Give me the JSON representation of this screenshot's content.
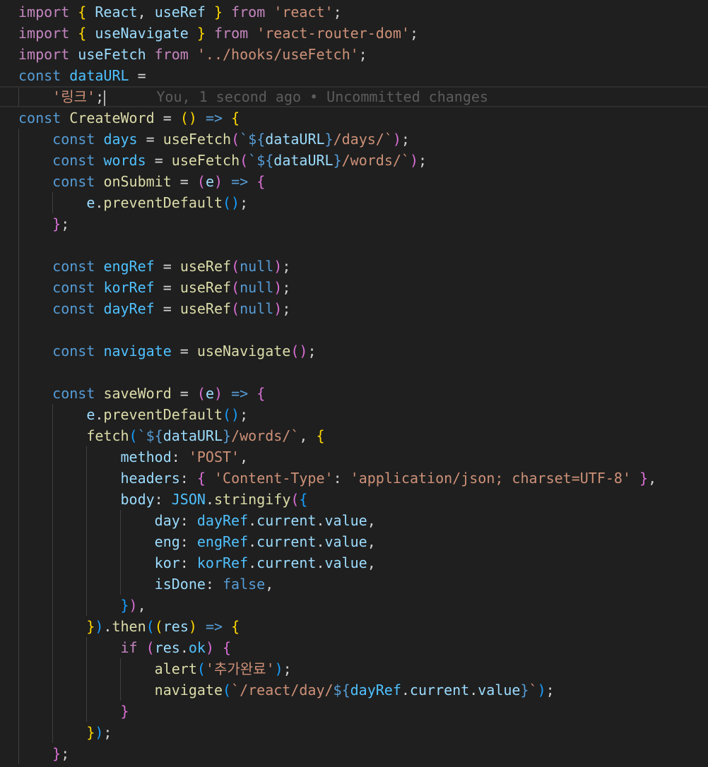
{
  "colors": {
    "background": "#1f1f1f",
    "keyword": "#c586c0",
    "storage": "#569cd6",
    "variable": "#9cdcfe",
    "constant": "#4fc1ff",
    "function": "#dcdcaa",
    "string": "#ce9178",
    "punctuation": "#d4d4d4",
    "bracket_gold": "#ffd700",
    "bracket_purple": "#da70d6",
    "bracket_blue": "#179fff",
    "blame": "#5c5c5c"
  },
  "git_blame": "You, 1 second ago • Uncommitted changes",
  "code_lines": [
    [
      [
        "import",
        "keyword"
      ],
      [
        " ",
        "punctuation"
      ],
      [
        "{",
        "bracket_gold"
      ],
      [
        " ",
        "punctuation"
      ],
      [
        "React",
        "variable"
      ],
      [
        ", ",
        "punctuation"
      ],
      [
        "useRef",
        "variable"
      ],
      [
        " ",
        "punctuation"
      ],
      [
        "}",
        "bracket_gold"
      ],
      [
        " ",
        "punctuation"
      ],
      [
        "from",
        "keyword"
      ],
      [
        " ",
        "punctuation"
      ],
      [
        "'react'",
        "string"
      ],
      [
        ";",
        "punctuation"
      ]
    ],
    [
      [
        "import",
        "keyword"
      ],
      [
        " ",
        "punctuation"
      ],
      [
        "{",
        "bracket_gold"
      ],
      [
        " ",
        "punctuation"
      ],
      [
        "useNavigate",
        "variable"
      ],
      [
        " ",
        "punctuation"
      ],
      [
        "}",
        "bracket_gold"
      ],
      [
        " ",
        "punctuation"
      ],
      [
        "from",
        "keyword"
      ],
      [
        " ",
        "punctuation"
      ],
      [
        "'react-router-dom'",
        "string"
      ],
      [
        ";",
        "punctuation"
      ]
    ],
    [
      [
        "import",
        "keyword"
      ],
      [
        " ",
        "punctuation"
      ],
      [
        "useFetch",
        "variable"
      ],
      [
        " ",
        "punctuation"
      ],
      [
        "from",
        "keyword"
      ],
      [
        " ",
        "punctuation"
      ],
      [
        "'../hooks/useFetch'",
        "string"
      ],
      [
        ";",
        "punctuation"
      ]
    ],
    [
      [
        "const",
        "storage"
      ],
      [
        " ",
        "punctuation"
      ],
      [
        "dataURL",
        "constant"
      ],
      [
        " =",
        "punctuation"
      ]
    ],
    [
      [
        "    ",
        "punctuation"
      ],
      [
        "'링크'",
        "string"
      ],
      [
        ";",
        "punctuation"
      ]
    ],
    [
      [
        "const",
        "storage"
      ],
      [
        " ",
        "punctuation"
      ],
      [
        "CreateWord",
        "function"
      ],
      [
        " = ",
        "punctuation"
      ],
      [
        "()",
        "bracket_gold"
      ],
      [
        " ",
        "punctuation"
      ],
      [
        "=>",
        "storage"
      ],
      [
        " ",
        "punctuation"
      ],
      [
        "{",
        "bracket_gold"
      ]
    ],
    [
      [
        "    ",
        "punctuation"
      ],
      [
        "const",
        "storage"
      ],
      [
        " ",
        "punctuation"
      ],
      [
        "days",
        "constant"
      ],
      [
        " = ",
        "punctuation"
      ],
      [
        "useFetch",
        "function"
      ],
      [
        "(",
        "bracket_purple"
      ],
      [
        "`${",
        "storage"
      ],
      [
        "dataURL",
        "variable"
      ],
      [
        "}",
        "storage"
      ],
      [
        "/days/`",
        "string"
      ],
      [
        ")",
        "bracket_purple"
      ],
      [
        ";",
        "punctuation"
      ]
    ],
    [
      [
        "    ",
        "punctuation"
      ],
      [
        "const",
        "storage"
      ],
      [
        " ",
        "punctuation"
      ],
      [
        "words",
        "constant"
      ],
      [
        " = ",
        "punctuation"
      ],
      [
        "useFetch",
        "function"
      ],
      [
        "(",
        "bracket_purple"
      ],
      [
        "`${",
        "storage"
      ],
      [
        "dataURL",
        "variable"
      ],
      [
        "}",
        "storage"
      ],
      [
        "/words/`",
        "string"
      ],
      [
        ")",
        "bracket_purple"
      ],
      [
        ";",
        "punctuation"
      ]
    ],
    [
      [
        "    ",
        "punctuation"
      ],
      [
        "const",
        "storage"
      ],
      [
        " ",
        "punctuation"
      ],
      [
        "onSubmit",
        "function"
      ],
      [
        " = ",
        "punctuation"
      ],
      [
        "(",
        "bracket_purple"
      ],
      [
        "e",
        "variable"
      ],
      [
        ")",
        "bracket_purple"
      ],
      [
        " ",
        "punctuation"
      ],
      [
        "=>",
        "storage"
      ],
      [
        " ",
        "punctuation"
      ],
      [
        "{",
        "bracket_purple"
      ]
    ],
    [
      [
        "        ",
        "punctuation"
      ],
      [
        "e",
        "variable"
      ],
      [
        ".",
        "punctuation"
      ],
      [
        "preventDefault",
        "function"
      ],
      [
        "()",
        "bracket_blue"
      ],
      [
        ";",
        "punctuation"
      ]
    ],
    [
      [
        "    ",
        "punctuation"
      ],
      [
        "}",
        "bracket_purple"
      ],
      [
        ";",
        "punctuation"
      ]
    ],
    [],
    [
      [
        "    ",
        "punctuation"
      ],
      [
        "const",
        "storage"
      ],
      [
        " ",
        "punctuation"
      ],
      [
        "engRef",
        "constant"
      ],
      [
        " = ",
        "punctuation"
      ],
      [
        "useRef",
        "function"
      ],
      [
        "(",
        "bracket_purple"
      ],
      [
        "null",
        "storage"
      ],
      [
        ")",
        "bracket_purple"
      ],
      [
        ";",
        "punctuation"
      ]
    ],
    [
      [
        "    ",
        "punctuation"
      ],
      [
        "const",
        "storage"
      ],
      [
        " ",
        "punctuation"
      ],
      [
        "korRef",
        "constant"
      ],
      [
        " = ",
        "punctuation"
      ],
      [
        "useRef",
        "function"
      ],
      [
        "(",
        "bracket_purple"
      ],
      [
        "null",
        "storage"
      ],
      [
        ")",
        "bracket_purple"
      ],
      [
        ";",
        "punctuation"
      ]
    ],
    [
      [
        "    ",
        "punctuation"
      ],
      [
        "const",
        "storage"
      ],
      [
        " ",
        "punctuation"
      ],
      [
        "dayRef",
        "constant"
      ],
      [
        " = ",
        "punctuation"
      ],
      [
        "useRef",
        "function"
      ],
      [
        "(",
        "bracket_purple"
      ],
      [
        "null",
        "storage"
      ],
      [
        ")",
        "bracket_purple"
      ],
      [
        ";",
        "punctuation"
      ]
    ],
    [],
    [
      [
        "    ",
        "punctuation"
      ],
      [
        "const",
        "storage"
      ],
      [
        " ",
        "punctuation"
      ],
      [
        "navigate",
        "constant"
      ],
      [
        " = ",
        "punctuation"
      ],
      [
        "useNavigate",
        "function"
      ],
      [
        "()",
        "bracket_purple"
      ],
      [
        ";",
        "punctuation"
      ]
    ],
    [],
    [
      [
        "    ",
        "punctuation"
      ],
      [
        "const",
        "storage"
      ],
      [
        " ",
        "punctuation"
      ],
      [
        "saveWord",
        "function"
      ],
      [
        " = ",
        "punctuation"
      ],
      [
        "(",
        "bracket_purple"
      ],
      [
        "e",
        "variable"
      ],
      [
        ")",
        "bracket_purple"
      ],
      [
        " ",
        "punctuation"
      ],
      [
        "=>",
        "storage"
      ],
      [
        " ",
        "punctuation"
      ],
      [
        "{",
        "bracket_purple"
      ]
    ],
    [
      [
        "        ",
        "punctuation"
      ],
      [
        "e",
        "variable"
      ],
      [
        ".",
        "punctuation"
      ],
      [
        "preventDefault",
        "function"
      ],
      [
        "()",
        "bracket_blue"
      ],
      [
        ";",
        "punctuation"
      ]
    ],
    [
      [
        "        ",
        "punctuation"
      ],
      [
        "fetch",
        "function"
      ],
      [
        "(",
        "bracket_blue"
      ],
      [
        "`${",
        "storage"
      ],
      [
        "dataURL",
        "variable"
      ],
      [
        "}",
        "storage"
      ],
      [
        "/words/`",
        "string"
      ],
      [
        ", ",
        "punctuation"
      ],
      [
        "{",
        "bracket_gold"
      ]
    ],
    [
      [
        "            ",
        "punctuation"
      ],
      [
        "method",
        "variable"
      ],
      [
        ": ",
        "punctuation"
      ],
      [
        "'POST'",
        "string"
      ],
      [
        ",",
        "punctuation"
      ]
    ],
    [
      [
        "            ",
        "punctuation"
      ],
      [
        "headers",
        "variable"
      ],
      [
        ": ",
        "punctuation"
      ],
      [
        "{",
        "bracket_purple"
      ],
      [
        " ",
        "punctuation"
      ],
      [
        "'Content-Type'",
        "string"
      ],
      [
        ": ",
        "punctuation"
      ],
      [
        "'application/json; charset=UTF-8'",
        "string"
      ],
      [
        " ",
        "punctuation"
      ],
      [
        "}",
        "bracket_purple"
      ],
      [
        ",",
        "punctuation"
      ]
    ],
    [
      [
        "            ",
        "punctuation"
      ],
      [
        "body",
        "variable"
      ],
      [
        ": ",
        "punctuation"
      ],
      [
        "JSON",
        "constant"
      ],
      [
        ".",
        "punctuation"
      ],
      [
        "stringify",
        "function"
      ],
      [
        "(",
        "bracket_purple"
      ],
      [
        "{",
        "bracket_blue"
      ]
    ],
    [
      [
        "                ",
        "punctuation"
      ],
      [
        "day",
        "variable"
      ],
      [
        ": ",
        "punctuation"
      ],
      [
        "dayRef",
        "constant"
      ],
      [
        ".",
        "punctuation"
      ],
      [
        "current",
        "variable"
      ],
      [
        ".",
        "punctuation"
      ],
      [
        "value",
        "variable"
      ],
      [
        ",",
        "punctuation"
      ]
    ],
    [
      [
        "                ",
        "punctuation"
      ],
      [
        "eng",
        "variable"
      ],
      [
        ": ",
        "punctuation"
      ],
      [
        "engRef",
        "constant"
      ],
      [
        ".",
        "punctuation"
      ],
      [
        "current",
        "variable"
      ],
      [
        ".",
        "punctuation"
      ],
      [
        "value",
        "variable"
      ],
      [
        ",",
        "punctuation"
      ]
    ],
    [
      [
        "                ",
        "punctuation"
      ],
      [
        "kor",
        "variable"
      ],
      [
        ": ",
        "punctuation"
      ],
      [
        "korRef",
        "constant"
      ],
      [
        ".",
        "punctuation"
      ],
      [
        "current",
        "variable"
      ],
      [
        ".",
        "punctuation"
      ],
      [
        "value",
        "variable"
      ],
      [
        ",",
        "punctuation"
      ]
    ],
    [
      [
        "                ",
        "punctuation"
      ],
      [
        "isDone",
        "variable"
      ],
      [
        ": ",
        "punctuation"
      ],
      [
        "false",
        "storage"
      ],
      [
        ",",
        "punctuation"
      ]
    ],
    [
      [
        "            ",
        "punctuation"
      ],
      [
        "}",
        "bracket_blue"
      ],
      [
        ")",
        "bracket_purple"
      ],
      [
        ",",
        "punctuation"
      ]
    ],
    [
      [
        "        ",
        "punctuation"
      ],
      [
        "}",
        "bracket_gold"
      ],
      [
        ")",
        "bracket_blue"
      ],
      [
        ".",
        "punctuation"
      ],
      [
        "then",
        "function"
      ],
      [
        "(",
        "bracket_blue"
      ],
      [
        "(",
        "bracket_gold"
      ],
      [
        "res",
        "variable"
      ],
      [
        ")",
        "bracket_gold"
      ],
      [
        " ",
        "punctuation"
      ],
      [
        "=>",
        "storage"
      ],
      [
        " ",
        "punctuation"
      ],
      [
        "{",
        "bracket_gold"
      ]
    ],
    [
      [
        "            ",
        "punctuation"
      ],
      [
        "if",
        "keyword"
      ],
      [
        " ",
        "punctuation"
      ],
      [
        "(",
        "bracket_purple"
      ],
      [
        "res",
        "variable"
      ],
      [
        ".",
        "punctuation"
      ],
      [
        "ok",
        "constant"
      ],
      [
        ")",
        "bracket_purple"
      ],
      [
        " ",
        "punctuation"
      ],
      [
        "{",
        "bracket_purple"
      ]
    ],
    [
      [
        "                ",
        "punctuation"
      ],
      [
        "alert",
        "function"
      ],
      [
        "(",
        "bracket_blue"
      ],
      [
        "'추가완료'",
        "string"
      ],
      [
        ")",
        "bracket_blue"
      ],
      [
        ";",
        "punctuation"
      ]
    ],
    [
      [
        "                ",
        "punctuation"
      ],
      [
        "navigate",
        "function"
      ],
      [
        "(",
        "bracket_blue"
      ],
      [
        "`/react/day/",
        "string"
      ],
      [
        "${",
        "storage"
      ],
      [
        "dayRef",
        "constant"
      ],
      [
        ".",
        "punctuation"
      ],
      [
        "current",
        "variable"
      ],
      [
        ".",
        "punctuation"
      ],
      [
        "value",
        "variable"
      ],
      [
        "}",
        "storage"
      ],
      [
        "`",
        "string"
      ],
      [
        ")",
        "bracket_blue"
      ],
      [
        ";",
        "punctuation"
      ]
    ],
    [
      [
        "            ",
        "punctuation"
      ],
      [
        "}",
        "bracket_purple"
      ]
    ],
    [
      [
        "        ",
        "punctuation"
      ],
      [
        "}",
        "bracket_gold"
      ],
      [
        ")",
        "bracket_blue"
      ],
      [
        ";",
        "punctuation"
      ]
    ],
    [
      [
        "    ",
        "punctuation"
      ],
      [
        "}",
        "bracket_purple"
      ],
      [
        ";",
        "punctuation"
      ]
    ]
  ]
}
